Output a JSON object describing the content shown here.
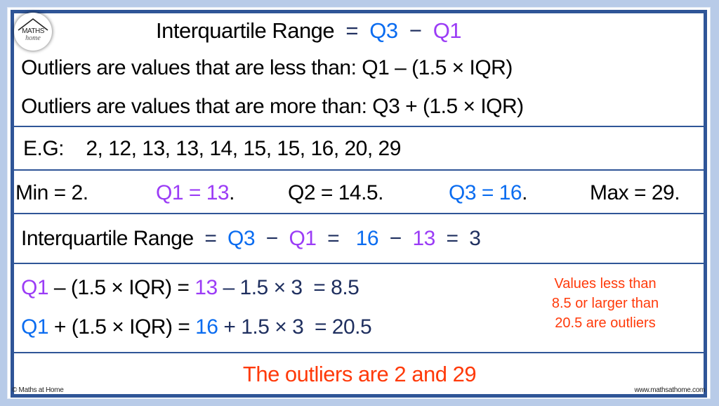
{
  "brand": {
    "logo_top": "MATHS",
    "logo_bottom": "home",
    "copyright": "© Maths at Home",
    "website": "www.mathsathome.com"
  },
  "colors": {
    "border": "#2f5597",
    "q3_blue": "#0a6cf0",
    "q1_purple": "#9b3cf6",
    "operator_navy": "#1f2f5f",
    "answer_red": "#ff3a0a"
  },
  "definition": {
    "label": "Interquartile Range",
    "eq": "=",
    "q3": "Q3",
    "minus": "−",
    "q1": "Q1"
  },
  "rules": {
    "lower": "Outliers are values that are less than: Q1 – (1.5 × IQR)",
    "upper": "Outliers are values that are more than: Q3 + (1.5 × IQR)"
  },
  "example": {
    "label": "E.G:",
    "values": "2, 12, 13, 13, 14, 15, 15, 16, 20, 29"
  },
  "summary": {
    "min": "Min = 2.",
    "q1": "Q1 = 13",
    "q1_dot": ".",
    "q2": "Q2 = 14.5.",
    "q3": "Q3 = 16",
    "q3_dot": ".",
    "max": "Max = 29."
  },
  "iqr_calc": {
    "label": "Interquartile Range",
    "eq1": "=",
    "q3": "Q3",
    "minus1": "−",
    "q1": "Q1",
    "eq2": "=",
    "q3_val": "16",
    "minus2": "−",
    "q1_val": "13",
    "eq3": "=",
    "result": "3"
  },
  "fences": {
    "lower": {
      "q": "Q1",
      "expr": " – (1.5 × IQR) = ",
      "val": "13",
      "rest": " – 1.5 × 3  = 8.5"
    },
    "upper": {
      "q": "Q1",
      "expr": " + (1.5 × IQR) = ",
      "val": "16",
      "rest": " + 1.5 × 3  = 20.5"
    },
    "note_line1": "Values less than",
    "note_line2": "8.5 or larger than",
    "note_line3": "20.5 are outliers"
  },
  "conclusion": "The outliers are 2 and 29"
}
